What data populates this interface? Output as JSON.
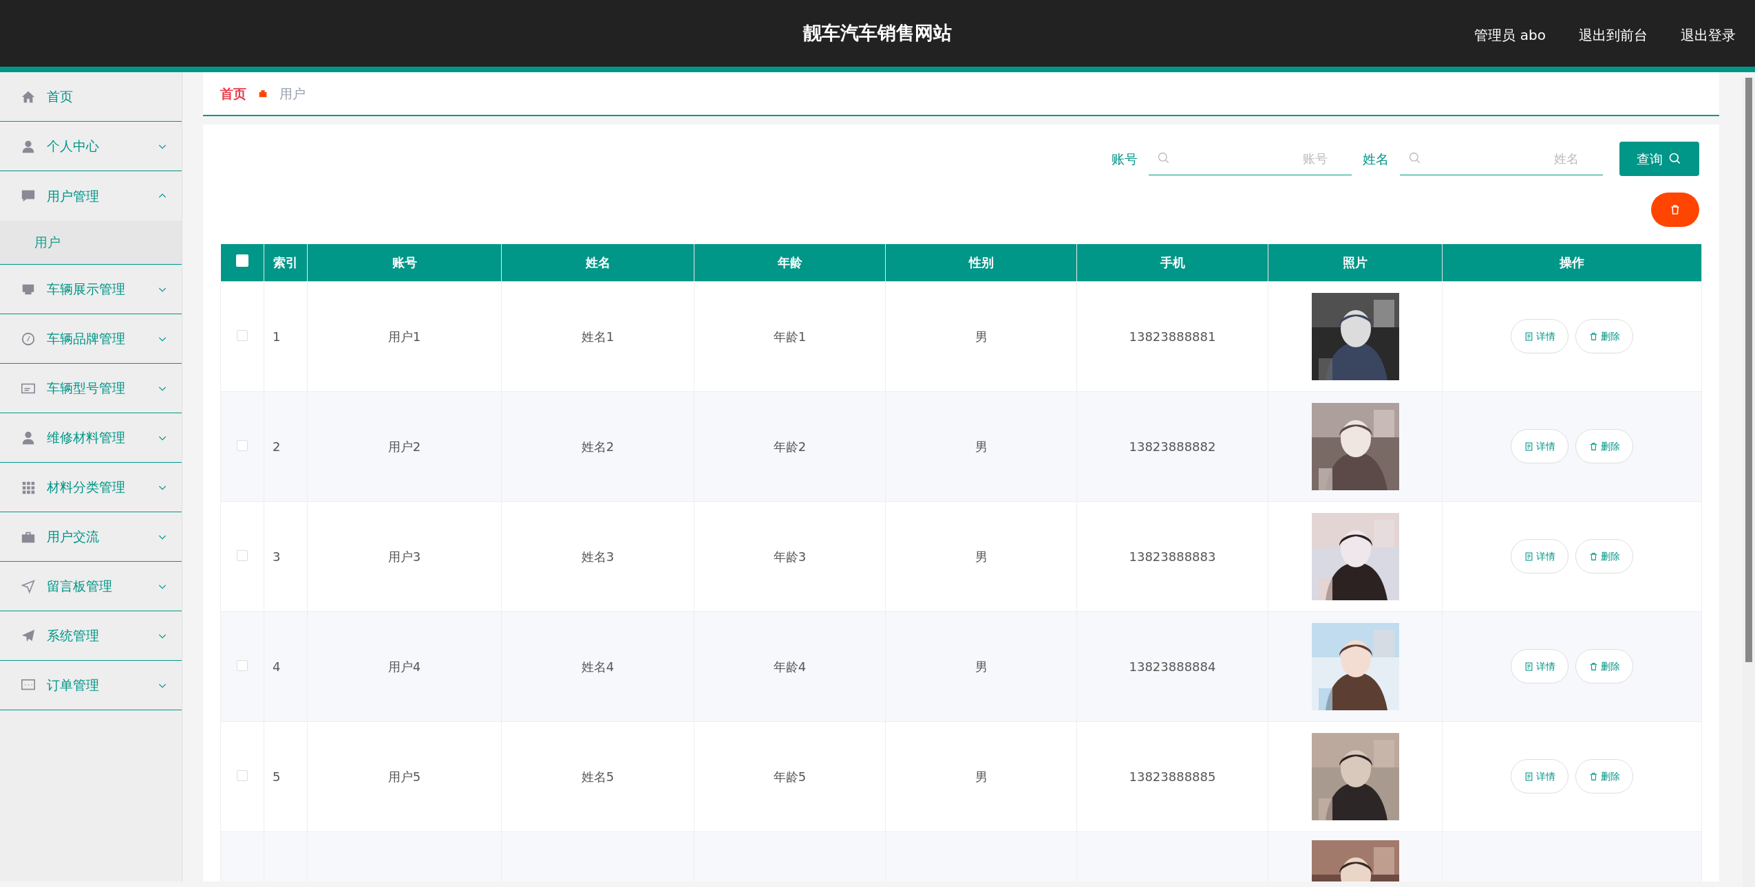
{
  "header": {
    "title": "靓车汽车销售网站",
    "links": [
      "管理员 abo",
      "退出到前台",
      "退出登录"
    ]
  },
  "sidebar": {
    "items": [
      {
        "label": "首页"
      },
      {
        "label": "个人中心",
        "expanded": false
      },
      {
        "label": "用户管理",
        "expanded": true,
        "children": [
          {
            "label": "用户"
          }
        ]
      },
      {
        "label": "车辆展示管理",
        "expanded": false
      },
      {
        "label": "车辆品牌管理",
        "expanded": false
      },
      {
        "label": "车辆型号管理",
        "expanded": false
      },
      {
        "label": "维修材料管理",
        "expanded": false
      },
      {
        "label": "材料分类管理",
        "expanded": false
      },
      {
        "label": "用户交流",
        "expanded": false
      },
      {
        "label": "留言板管理",
        "expanded": false
      },
      {
        "label": "系统管理",
        "expanded": false
      },
      {
        "label": "订单管理",
        "expanded": false
      }
    ]
  },
  "breadcrumb": [
    "首页",
    "用户"
  ],
  "search": {
    "fields": [
      {
        "label": "账号",
        "placeholder": "账号"
      },
      {
        "label": "姓名",
        "placeholder": "姓名"
      }
    ],
    "button": "查询"
  },
  "table": {
    "select_all": {
      "checked": false
    },
    "columns": [
      "索引",
      "账号",
      "姓名",
      "年龄",
      "性别",
      "手机",
      "照片",
      "操作"
    ],
    "rows": [
      {
        "checked": false,
        "cells": [
          "1",
          "用户1",
          "姓名1",
          "年龄1",
          "男",
          "13823888881"
        ],
        "actions": [
          "详情",
          "删除"
        ]
      },
      {
        "checked": false,
        "cells": [
          "2",
          "用户2",
          "姓名2",
          "年龄2",
          "男",
          "13823888882"
        ],
        "actions": [
          "详情",
          "删除"
        ]
      },
      {
        "checked": false,
        "cells": [
          "3",
          "用户3",
          "姓名3",
          "年龄3",
          "男",
          "13823888883"
        ],
        "actions": [
          "详情",
          "删除"
        ]
      },
      {
        "checked": false,
        "cells": [
          "4",
          "用户4",
          "姓名4",
          "年龄4",
          "男",
          "13823888884"
        ],
        "actions": [
          "详情",
          "删除"
        ]
      },
      {
        "checked": false,
        "cells": [
          "5",
          "用户5",
          "姓名5",
          "年龄5",
          "男",
          "13823888885"
        ],
        "actions": [
          "详情",
          "删除"
        ]
      }
    ]
  }
}
